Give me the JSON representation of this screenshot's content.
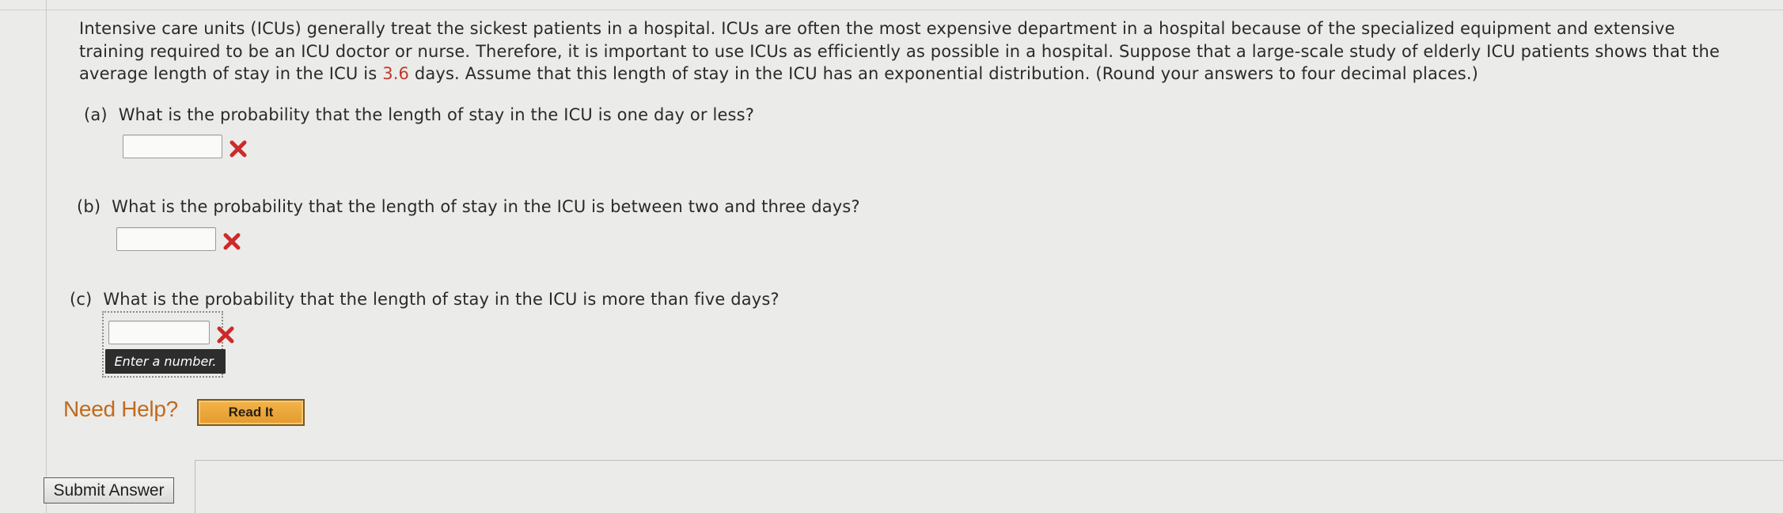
{
  "problem": {
    "intro_before": "Intensive care units (ICUs) generally treat the sickest patients in a hospital. ICUs are often the most expensive department in a hospital because of the specialized equipment and extensive training required to be an ICU doctor or nurse. Therefore, it is important to use ICUs as efficiently as possible in a hospital. Suppose that a large-scale study of elderly ICU patients shows that the average length of stay in the ICU is ",
    "mean_value": "3.6",
    "intro_after": " days. Assume that this length of stay in the ICU has an exponential distribution. (Round your answers to four decimal places.)",
    "highlight_color": "#c0392b"
  },
  "questions": [
    {
      "part": "(a)",
      "text": "What is the probability that the length of stay in the ICU is one day or less?",
      "value": "",
      "status": "incorrect"
    },
    {
      "part": "(b)",
      "text": "What is the probability that the length of stay in the ICU is between two and three days?",
      "value": "",
      "status": "incorrect"
    },
    {
      "part": "(c)",
      "text": "What is the probability that the length of stay in the ICU is more than five days?",
      "value": "",
      "status": "incorrect",
      "focused": true
    }
  ],
  "tooltip": {
    "text": "Enter a number."
  },
  "help": {
    "label": "Need Help?",
    "read_it_label": "Read It"
  },
  "submit": {
    "label": "Submit Answer"
  },
  "icons": {
    "incorrect": "close-icon",
    "color": "#cc2a2a"
  },
  "colors": {
    "need_help": "#c16a1e",
    "read_it_bg": "#e9a53a"
  }
}
